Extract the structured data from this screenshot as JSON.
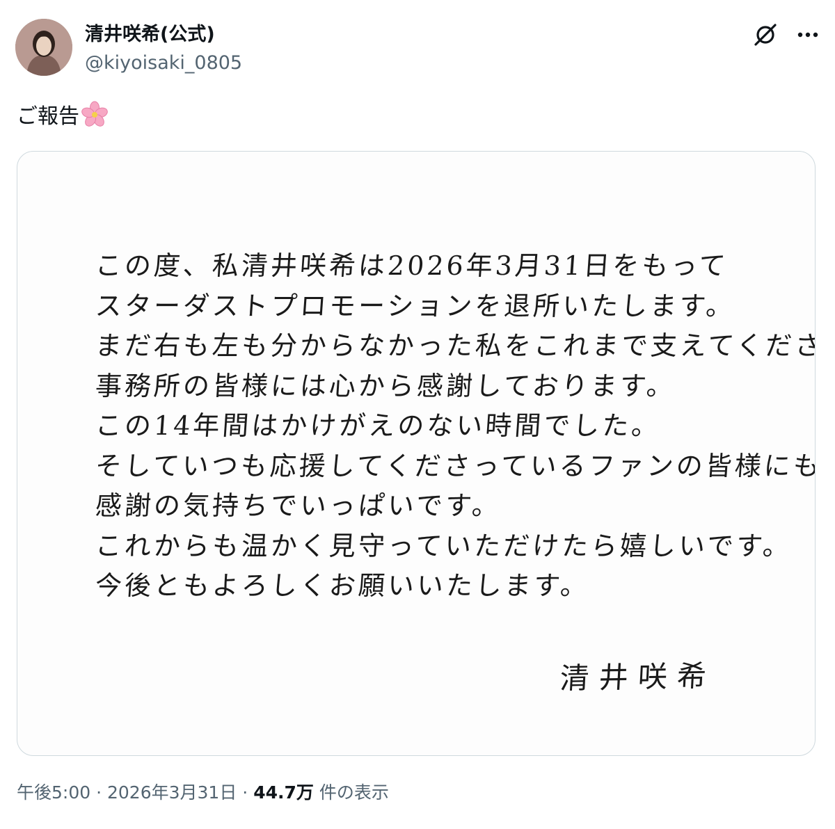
{
  "author": {
    "display_name": "清井咲希(公式)",
    "handle": "@kiyoisaki_0805"
  },
  "post": {
    "text": "ご報告",
    "emoji": "cherry-blossom"
  },
  "letter": {
    "lines": [
      "この度、私清井咲希は2026年3月31日をもって",
      "スターダストプロモーションを退所いたします。",
      "まだ右も左も分からなかった私をこれまで支えてくださった",
      "事務所の皆様には心から感謝しております。",
      "この14年間はかけがえのない時間でした。",
      "そしていつも応援してくださっているファンの皆様にも",
      "感謝の気持ちでいっぱいです。",
      "これからも温かく見守っていただけたら嬉しいです。",
      "今後ともよろしくお願いいたします。"
    ],
    "signature": "清井咲希"
  },
  "meta": {
    "time": "午後5:00",
    "separator": "·",
    "date": "2026年3月31日",
    "views_count": "44.7万",
    "views_label": "件の表示"
  },
  "colors": {
    "text_primary": "#0f1419",
    "text_secondary": "#536471",
    "border": "#cfd9de"
  },
  "icons": {
    "grok": "grok-icon",
    "more": "more-icon"
  }
}
